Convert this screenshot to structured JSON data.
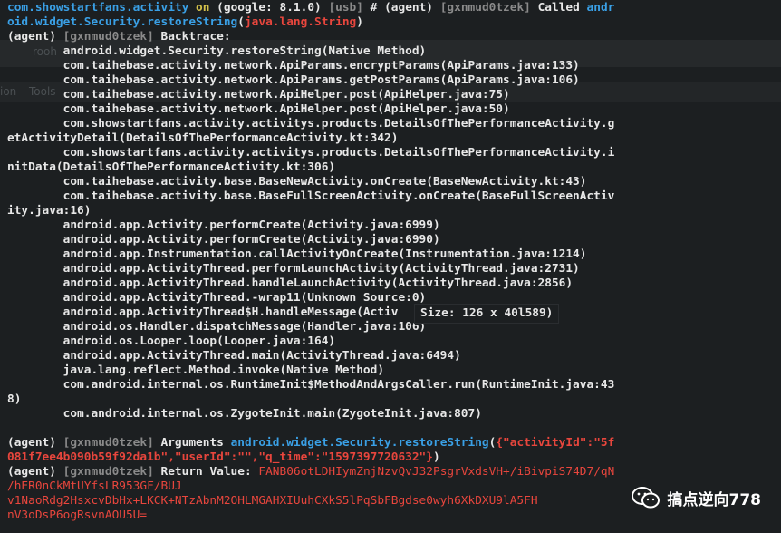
{
  "background": {
    "window_title_fragment": "rooh",
    "menu_items": [
      "ion",
      "Tools"
    ]
  },
  "terminal": {
    "lines": [
      [
        {
          "c": "blue",
          "t": "com.showstartfans.activity"
        },
        {
          "c": "yellow",
          "t": " on "
        },
        {
          "c": "white",
          "t": "(google: 8.1.0) "
        },
        {
          "c": "grey",
          "t": "[usb]"
        },
        {
          "c": "white",
          "t": " # (agent) "
        },
        {
          "c": "grey",
          "t": "[gxnmud0tzek]"
        },
        {
          "c": "white",
          "t": " Called "
        },
        {
          "c": "blue",
          "t": "andr"
        }
      ],
      [
        {
          "c": "blue",
          "t": "oid.widget.Security.restoreString"
        },
        {
          "c": "white",
          "t": "("
        },
        {
          "c": "red",
          "t": "java.lang.String"
        },
        {
          "c": "white",
          "t": ")"
        }
      ],
      [
        {
          "c": "white",
          "t": "(agent) "
        },
        {
          "c": "grey",
          "t": "[gxnmud0tzek]"
        },
        {
          "c": "white",
          "t": " Backtrace:"
        }
      ],
      [
        {
          "c": "white",
          "t": "        android.widget.Security.restoreString(Native Method)"
        }
      ],
      [
        {
          "c": "white",
          "t": "        com.taihebase.activity.network.ApiParams.encryptParams(ApiParams.java:133)"
        }
      ],
      [
        {
          "c": "white",
          "t": "        com.taihebase.activity.network.ApiParams.getPostParams(ApiParams.java:106)"
        }
      ],
      [
        {
          "c": "white",
          "t": "        com.taihebase.activity.network.ApiHelper.post(ApiHelper.java:75)"
        }
      ],
      [
        {
          "c": "white",
          "t": "        com.taihebase.activity.network.ApiHelper.post(ApiHelper.java:50)"
        }
      ],
      [
        {
          "c": "white",
          "t": "        com.showstartfans.activity.activitys.products.DetailsOfThePerformanceActivity.g"
        }
      ],
      [
        {
          "c": "white",
          "t": "etActivityDetail(DetailsOfThePerformanceActivity.kt:342)"
        }
      ],
      [
        {
          "c": "white",
          "t": "        com.showstartfans.activity.activitys.products.DetailsOfThePerformanceActivity.i"
        }
      ],
      [
        {
          "c": "white",
          "t": "nitData(DetailsOfThePerformanceActivity.kt:306)"
        }
      ],
      [
        {
          "c": "white",
          "t": "        com.taihebase.activity.base.BaseNewActivity.onCreate(BaseNewActivity.kt:43)"
        }
      ],
      [
        {
          "c": "white",
          "t": "        com.taihebase.activity.base.BaseFullScreenActivity.onCreate(BaseFullScreenActiv"
        }
      ],
      [
        {
          "c": "white",
          "t": "ity.java:16)"
        }
      ],
      [
        {
          "c": "white",
          "t": "        android.app.Activity.performCreate(Activity.java:6999)"
        }
      ],
      [
        {
          "c": "white",
          "t": "        android.app.Activity.performCreate(Activity.java:6990)"
        }
      ],
      [
        {
          "c": "white",
          "t": "        android.app.Instrumentation.callActivityOnCreate(Instrumentation.java:1214)"
        }
      ],
      [
        {
          "c": "white",
          "t": "        android.app.ActivityThread.performLaunchActivity(ActivityThread.java:2731)"
        }
      ],
      [
        {
          "c": "white",
          "t": "        android.app.ActivityThread.handleLaunchActivity(ActivityThread.java:2856)"
        }
      ],
      [
        {
          "c": "white",
          "t": "        android.app.ActivityThread.-wrap11(Unknown Source:0)"
        }
      ],
      [
        {
          "c": "white",
          "t": "        android.app.ActivityThread$H.handleMessage(Activ"
        }
      ],
      [
        {
          "c": "white",
          "t": "        android.os.Handler.dispatchMessage(Handler.java:106)"
        }
      ],
      [
        {
          "c": "white",
          "t": "        android.os.Looper.loop(Looper.java:164)"
        }
      ],
      [
        {
          "c": "white",
          "t": "        android.app.ActivityThread.main(ActivityThread.java:6494)"
        }
      ],
      [
        {
          "c": "white",
          "t": "        java.lang.reflect.Method.invoke(Native Method)"
        }
      ],
      [
        {
          "c": "white",
          "t": "        com.android.internal.os.RuntimeInit$MethodAndArgsCaller.run(RuntimeInit.java:43"
        }
      ],
      [
        {
          "c": "white",
          "t": "8)"
        }
      ],
      [
        {
          "c": "white",
          "t": "        com.android.internal.os.ZygoteInit.main(ZygoteInit.java:807)"
        }
      ],
      [],
      [
        {
          "c": "white",
          "t": "(agent) "
        },
        {
          "c": "grey",
          "t": "[gxnmud0tzek]"
        },
        {
          "c": "white",
          "t": " Arguments "
        },
        {
          "c": "blue",
          "t": "android.widget.Security.restoreString"
        },
        {
          "c": "white",
          "t": "("
        },
        {
          "c": "red",
          "t": "{\"activityId\":\"5f"
        }
      ],
      [
        {
          "c": "red",
          "t": "081f7ee4b090b59f92da1b\",\"userId\":\"\",\"q_time\":\"1597397720632\"}"
        },
        {
          "c": "white",
          "t": ")"
        }
      ],
      [
        {
          "c": "white",
          "t": "(agent) "
        },
        {
          "c": "grey",
          "t": "[gxnmud0tzek]"
        },
        {
          "c": "white",
          "t": " Return Value: "
        },
        {
          "c": "redv",
          "t": "FANB06otLDHIymZnjNzvQvJ32PsgrVxdsVH+/iBivpiS74D7/qN"
        }
      ],
      [
        {
          "c": "redv",
          "t": "/hER0nCkMtUYfsLR953GF/BUJ"
        }
      ],
      [
        {
          "c": "redv",
          "t": "v1NaoRdg2HsxcvDbHx+LKCK+NTzAbnM2OHLMGAHXIUuhCXkS5lPqSbFBgdse0wyh6XkDXU9lA5FH"
        }
      ],
      [
        {
          "c": "redv",
          "t": "nV3oDsP6ogRsvnAOU5U="
        }
      ]
    ]
  },
  "tooltip": {
    "text": "Size: 126 x 40l589)"
  },
  "watermark": {
    "icon": "wechat-icon",
    "text": "搞点逆向778"
  }
}
